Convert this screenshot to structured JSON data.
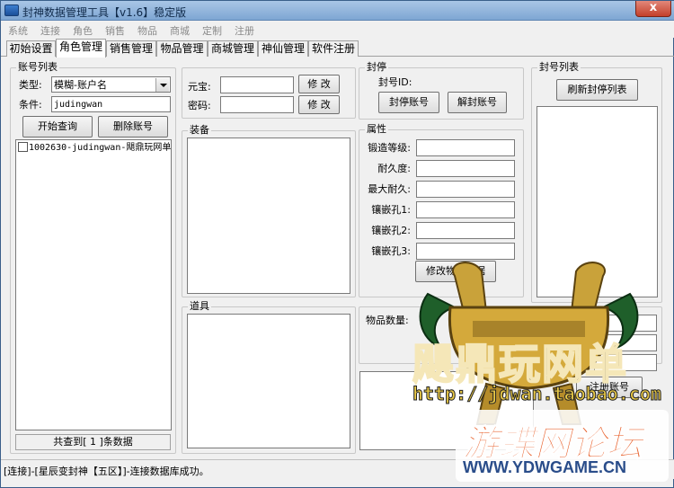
{
  "window": {
    "title": "封神数据管理工具【v1.6】稳定版",
    "close_label": "x"
  },
  "menu": [
    "系统",
    "连接",
    "角色",
    "销售",
    "物品",
    "商城",
    "定制",
    "注册"
  ],
  "tabs": [
    "初始设置",
    "角色管理",
    "销售管理",
    "物品管理",
    "商城管理",
    "神仙管理",
    "软件注册"
  ],
  "account_list": {
    "group_label": "账号列表",
    "type_label": "类型:",
    "type_value": "模糊-账户名",
    "condition_label": "条件:",
    "condition_value": "judingwan",
    "query_button": "开始查询",
    "delete_button": "删除账号",
    "items": [
      "1002630-judingwan-飓鼎玩网单"
    ],
    "count_text": "共查到[ 1 ]条数据"
  },
  "currency": {
    "yuanbao_label": "元宝:",
    "password_label": "密码:",
    "modify_label": "修 改"
  },
  "equipment": {
    "group_label": "装备"
  },
  "props": {
    "group_label": "道具"
  },
  "ban": {
    "group_label": "封停",
    "ban_id_label": "封号ID:",
    "ban_button": "封停账号",
    "unban_button": "解封账号"
  },
  "attributes": {
    "group_label": "属性",
    "fields": [
      "锻造等级:",
      "耐久度:",
      "最大耐久:",
      "镶嵌孔1:",
      "镶嵌孔2:",
      "镶嵌孔3:"
    ],
    "modify_button": "修改物品数据"
  },
  "item_count": {
    "label": "物品数量:",
    "register_button": "注册账号"
  },
  "ban_list": {
    "group_label": "封号列表",
    "refresh_button": "刷新封停列表"
  },
  "status": "[连接]-[星辰变封神【五区】]-连接数据库成功。",
  "watermark": {
    "brand": "飓鼎玩网单",
    "url": "http://jdwan.taobao.com",
    "site": "游蝶网论坛",
    "site_url": "WWW.YDWGAME.CN"
  }
}
